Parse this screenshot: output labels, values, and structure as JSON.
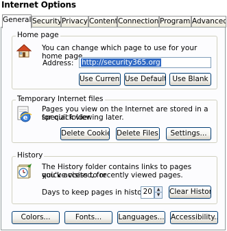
{
  "window": {
    "title": "Internet Options"
  },
  "tabs": [
    {
      "label": "General"
    },
    {
      "label": "Security"
    },
    {
      "label": "Privacy"
    },
    {
      "label": "Content"
    },
    {
      "label": "Connections"
    },
    {
      "label": "Programs"
    },
    {
      "label": "Advanced"
    }
  ],
  "home_page": {
    "group_label": "Home page",
    "description": "You can change which page to use for your home page.",
    "address_label": "Address:",
    "address_value": "http://security365.org",
    "use_current": "Use Current",
    "use_default": "Use Default",
    "use_blank": "Use Blank"
  },
  "temp_files": {
    "group_label": "Temporary Internet files",
    "description_line1": "Pages you view on the Internet are stored in a special folder",
    "description_line2": "for quick viewing later.",
    "delete_cookies": "Delete Cookies...",
    "delete_files": "Delete Files...",
    "settings": "Settings..."
  },
  "history": {
    "group_label": "History",
    "description_line1": "The History folder contains links to pages you've visited, for",
    "description_line2": "quick access to recently viewed pages.",
    "days_label": "Days to keep pages in history:",
    "days_value": "20",
    "clear_history": "Clear History"
  },
  "bottom_buttons": {
    "colors": "Colors...",
    "fonts": "Fonts...",
    "languages": "Languages...",
    "accessibility": "Accessibility..."
  },
  "icons": {
    "home_page": "house-icon",
    "temp_files": "internet-explorer-page-icon",
    "history": "history-icon"
  }
}
